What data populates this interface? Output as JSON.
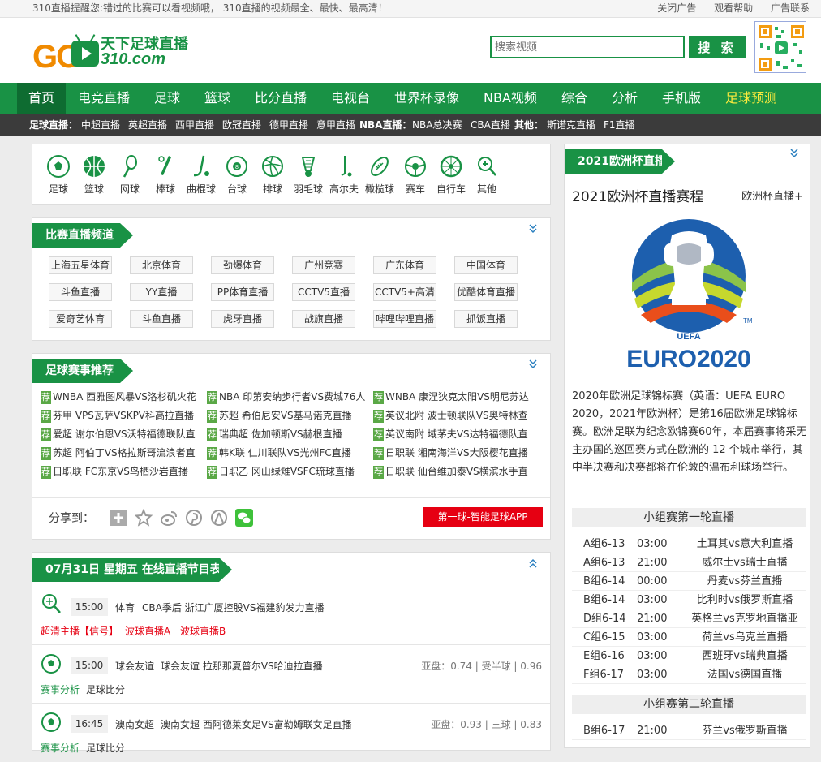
{
  "topbar": {
    "notice": "310直播提醒您:错过的比赛可以看视频哦， 310直播的视频最全、最快、最高清！",
    "close_ad": "关闭广告",
    "help": "观看帮助",
    "ad_contact": "广告联系"
  },
  "logo": {
    "go": "GO",
    "cn": "天下足球直播",
    "domain": "310.com"
  },
  "search": {
    "placeholder": "搜索视频",
    "button": "搜 索"
  },
  "nav": [
    "首页",
    "电竞直播",
    "足球",
    "篮球",
    "比分直播",
    "电视台",
    "世界杯录像",
    "NBA视频",
    "综合",
    "分析",
    "手机版",
    "足球预测"
  ],
  "subnav": {
    "football_label": "足球直播：",
    "football": [
      "中超直播",
      "英超直播",
      "西甲直播",
      "欧冠直播",
      "德甲直播",
      "意甲直播"
    ],
    "nba_label": "NBA直播：",
    "nba": [
      "NBA总决赛",
      "CBA直播"
    ],
    "other_label": "其他：",
    "other": [
      "斯诺克直播",
      "F1直播"
    ]
  },
  "sports": [
    "足球",
    "篮球",
    "网球",
    "棒球",
    "曲棍球",
    "台球",
    "排球",
    "羽毛球",
    "高尔夫",
    "橄榄球",
    "赛车",
    "自行车",
    "其他"
  ],
  "channels": {
    "title": "比赛直播频道",
    "items": [
      "上海五星体育",
      "北京体育",
      "劲爆体育",
      "广州竞赛",
      "广东体育",
      "中国体育",
      "斗鱼直播",
      "YY直播",
      "PP体育直播",
      "CCTV5直播",
      "CCTV5+高清",
      "优酷体育直播",
      "爱奇艺体育",
      "斗鱼直播",
      "虎牙直播",
      "战旗直播",
      "哔哩哔哩直播",
      "抓饭直播"
    ]
  },
  "recommend": {
    "title": "足球赛事推荐",
    "tag": "荐",
    "items": [
      "WNBA 西雅图风暴VS洛杉矶火花",
      "NBA 印第安纳步行者VS费城76人",
      "WNBA 康涅狄克太阳VS明尼苏达",
      "芬甲 VPS瓦萨VSKPV科高拉直播",
      "苏超 希伯尼安VS基马诺克直播",
      "英议北附 波士顿联队VS奥特林查",
      "爱超 谢尔伯恩VS沃特福德联队直",
      "瑞典超 佐加顿斯VS赫根直播",
      "英议南附 域茅夫VS达特福德队直",
      "苏超 阿伯丁VS格拉斯哥流浪者直",
      "韩K联 仁川联队VS光州FC直播",
      "日职联 湘南海洋VS大阪樱花直播",
      "日职联 FC东京VS鸟栖沙岩直播",
      "日职乙 冈山绿雉VSFC琉球直播",
      "日职联 仙台维加泰VS横滨水手直"
    ],
    "share_label": "分享到：",
    "app_button": "第一球-智能足球APP"
  },
  "schedule": {
    "title": "07月31日 星期五 在线直播节目表",
    "rows": [
      {
        "time": "15:00",
        "sport": "体育",
        "text": "CBA季后 浙江广厦控股VS福建豹发力直播",
        "links": [
          "超清主播【信号】",
          "波球直播A",
          "波球直播B"
        ]
      },
      {
        "time": "15:00",
        "sport": "球会友谊",
        "text": "球会友谊 拉那那夏普尔VS哈迪拉直播",
        "odds": "亚盘：0.74 | 受半球 | 0.96",
        "links": [
          "赛事分析",
          "足球比分"
        ]
      },
      {
        "time": "16:45",
        "sport": "澳南女超",
        "text": "澳南女超 西阿德莱女足VS富勒姆联女足直播",
        "odds": "亚盘：0.93 | 三球 | 0.83",
        "links": [
          "赛事分析",
          "足球比分"
        ]
      }
    ]
  },
  "euro": {
    "section": "2021欧洲杯直播",
    "heading": "2021欧洲杯直播赛程",
    "more": "欧洲杯直播+",
    "uefa": "UEFA",
    "logo_text": "EURO2020",
    "tm": "TM",
    "desc": "2020年欧洲足球锦标赛（英语：UEFA EURO 2020，2021年欧洲杯）是第16届欧洲足球锦标赛。欧洲足联为纪念欧锦赛60年，本届赛事将采无主办国的巡回赛方式在欧洲的 12 个城市举行，其中半决赛和决赛都将在伦敦的温布利球场举行。",
    "round1": "小组赛第一轮直播",
    "round2": "小组赛第二轮直播",
    "matches1": [
      {
        "g": "A组6-13",
        "t": "03:00",
        "n": "土耳其vs意大利直播"
      },
      {
        "g": "A组6-13",
        "t": "21:00",
        "n": "威尔士vs瑞士直播"
      },
      {
        "g": "B组6-14",
        "t": "00:00",
        "n": "丹麦vs芬兰直播"
      },
      {
        "g": "B组6-14",
        "t": "03:00",
        "n": "比利时vs俄罗斯直播"
      },
      {
        "g": "D组6-14",
        "t": "21:00",
        "n": "英格兰vs克罗地直播亚"
      },
      {
        "g": "C组6-15",
        "t": "03:00",
        "n": "荷兰vs乌克兰直播"
      },
      {
        "g": "E组6-16",
        "t": "03:00",
        "n": "西班牙vs瑞典直播"
      },
      {
        "g": "F组6-17",
        "t": "03:00",
        "n": "法国vs德国直播"
      }
    ],
    "matches2": [
      {
        "g": "B组6-17",
        "t": "21:00",
        "n": "芬兰vs俄罗斯直播"
      }
    ]
  }
}
